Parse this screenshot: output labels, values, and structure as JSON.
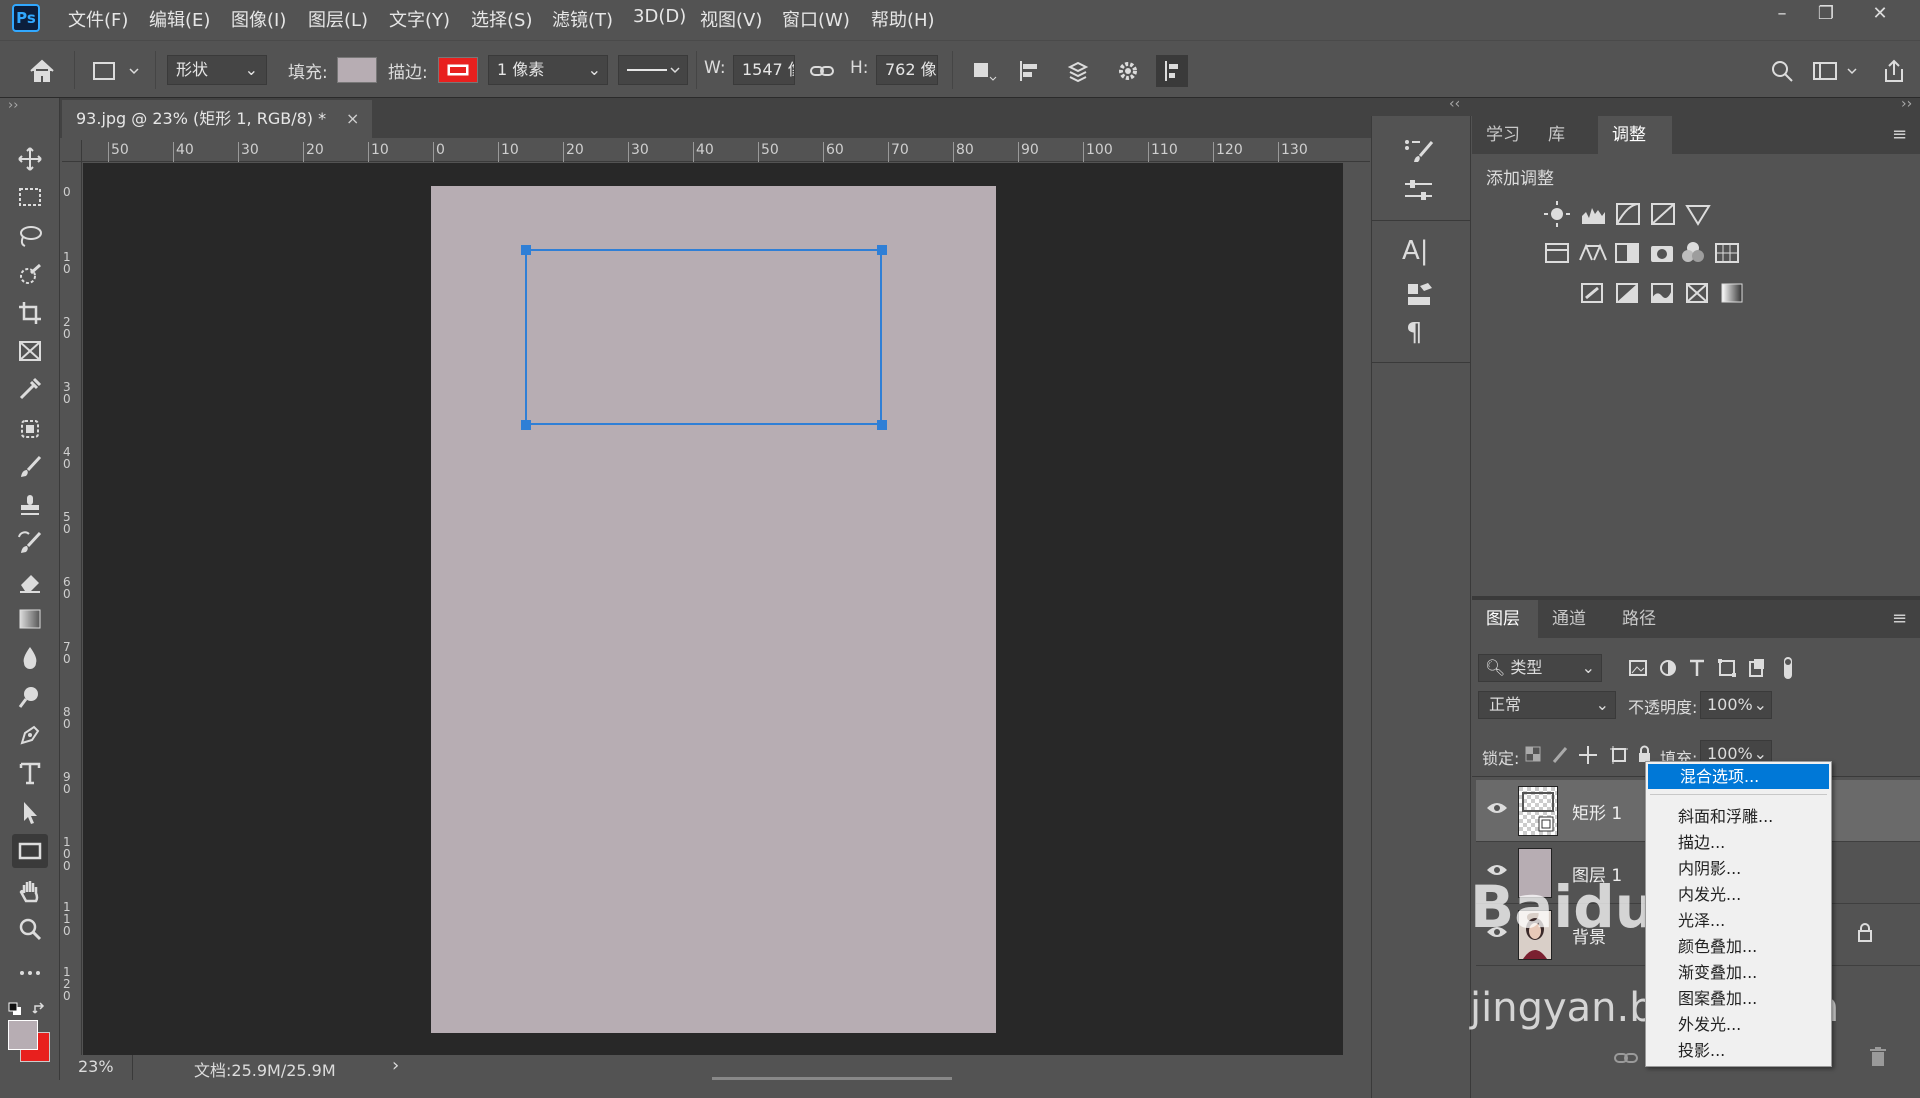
{
  "app": {
    "logo": "Ps"
  },
  "menu": [
    "文件(F)",
    "编辑(E)",
    "图像(I)",
    "图层(L)",
    "文字(Y)",
    "选择(S)",
    "滤镜(T)",
    "3D(D)",
    "视图(V)",
    "窗口(W)",
    "帮助(H)"
  ],
  "options": {
    "mode": "形状",
    "fill_label": "填充:",
    "stroke_label": "描边:",
    "stroke_width": "1 像素",
    "w_label": "W:",
    "w_value": "1547 像",
    "h_label": "H:",
    "h_value": "762 像"
  },
  "document": {
    "tab_title": "93.jpg @ 23% (矩形 1, RGB/8) *",
    "zoom": "23%",
    "doc_info": "文档:25.9M/25.9M",
    "ruler_h": [
      "50",
      "40",
      "30",
      "20",
      "10",
      "0",
      "10",
      "20",
      "30",
      "40",
      "50",
      "60",
      "70",
      "80",
      "90",
      "100",
      "110",
      "120",
      "130"
    ],
    "ruler_v": [
      "0",
      "1 0",
      "2 0",
      "3 0",
      "4 0",
      "5 0",
      "6 0",
      "7 0",
      "8 0",
      "9 0",
      "1 0 0",
      "1 1 0",
      "1 2 0"
    ]
  },
  "adjust_panel": {
    "tabs": [
      "学习",
      "库",
      "调整"
    ],
    "active_tab": "调整",
    "heading": "添加调整"
  },
  "layers_panel": {
    "tabs": [
      "图层",
      "通道",
      "路径"
    ],
    "active_tab": "图层",
    "filter": "类型",
    "blend_mode": "正常",
    "opacity_label": "不透明度:",
    "opacity_value": "100%",
    "lock_label": "锁定:",
    "fill_label": "填充:",
    "fill_value": "100%",
    "layers": [
      {
        "name": "矩形 1"
      },
      {
        "name": "图层 1"
      },
      {
        "name": "背景"
      }
    ]
  },
  "context_menu": {
    "items": [
      "混合选项...",
      "斜面和浮雕...",
      "描边...",
      "内阴影...",
      "内发光...",
      "光泽...",
      "颜色叠加...",
      "渐变叠加...",
      "图案叠加...",
      "外发光...",
      "投影..."
    ],
    "highlighted": "混合选项..."
  },
  "watermark": {
    "line1": "Baidu经验",
    "line2": "jingyan.baidu.com"
  },
  "colors": {
    "canvas": "#b7adb3",
    "selection": "#2f7fd6",
    "highlight": "#0078d7",
    "stroke_swatch": "#e8201e"
  }
}
